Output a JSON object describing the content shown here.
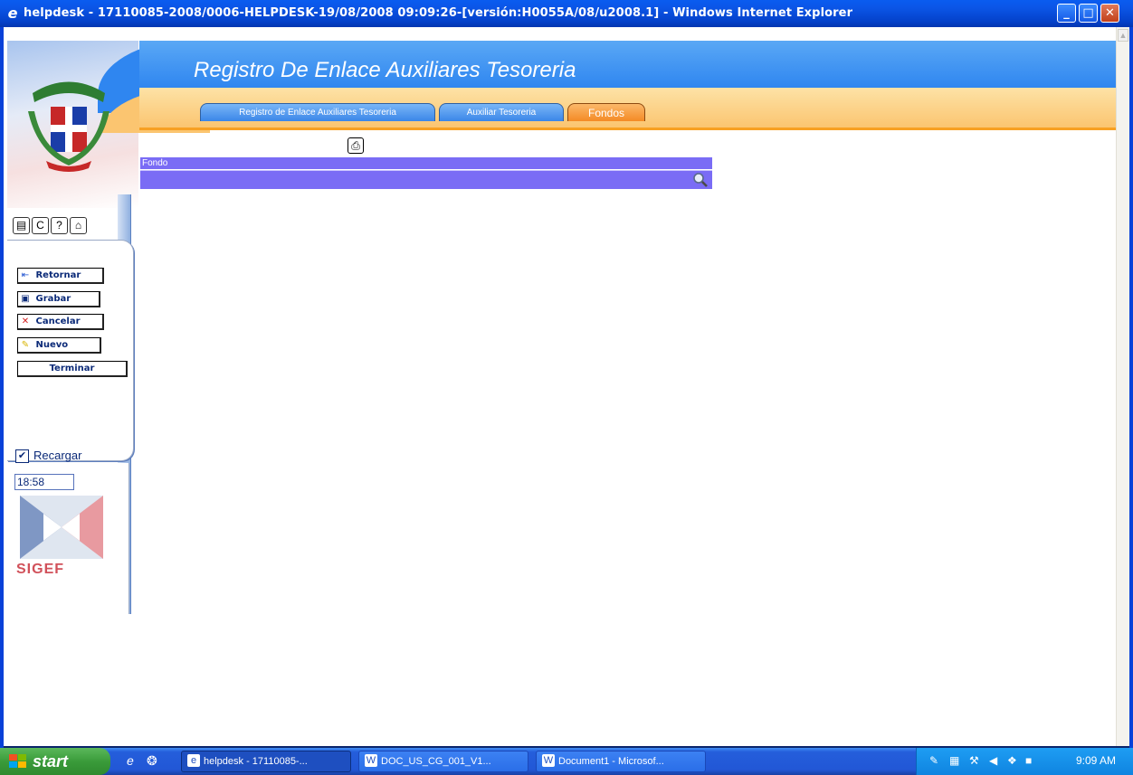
{
  "window": {
    "title": "helpdesk - 17110085-2008/0006-HELPDESK-19/08/2008 09:09:26-[versión:H0055A/08/u2008.1] - Windows Internet Explorer"
  },
  "header": {
    "title": "Registro De Enlace Auxiliares Tesoreria",
    "tabs": [
      {
        "label": "Registro de Enlace Auxiliares Tesoreria"
      },
      {
        "label": "Auxiliar Tesoreria"
      },
      {
        "label": "Fondos"
      }
    ]
  },
  "sidebar": {
    "buttons": [
      {
        "label": "Retornar",
        "icon": "arrow-left-bar-icon"
      },
      {
        "label": "Grabar",
        "icon": "floppy-icon"
      },
      {
        "label": "Cancelar",
        "icon": "red-x-icon"
      },
      {
        "label": "Nuevo",
        "icon": "pencil-icon"
      },
      {
        "label": "Terminar"
      }
    ],
    "recargar_label": "Recargar",
    "recargar_checked": true,
    "clock_value": "18:58",
    "brand": "SIGEF"
  },
  "form": {
    "fondo_label": "Fondo",
    "fondo_value": ""
  },
  "taskbar": {
    "start_label": "start",
    "items": [
      {
        "label": "helpdesk - 17110085-..."
      },
      {
        "label": "DOC_US_CG_001_V1..."
      },
      {
        "label": "Document1 - Microsof..."
      }
    ],
    "time": "9:09 AM"
  },
  "colors": {
    "header_blue": "#2f86f0",
    "tab_active": "#f48a25",
    "field_bg": "#7a6cf5",
    "sidebar_text": "#0b2a78"
  }
}
